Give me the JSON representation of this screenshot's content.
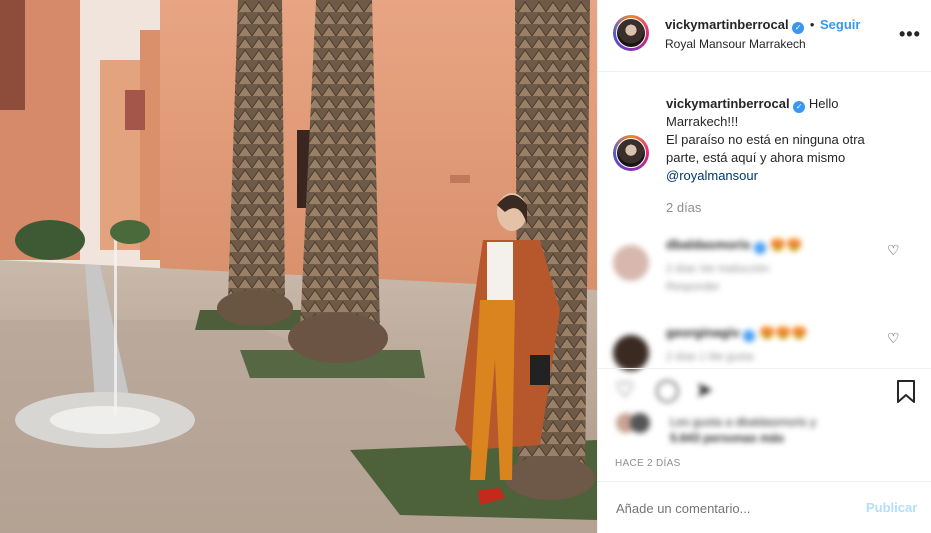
{
  "post": {
    "username": "vickymartinberrocal",
    "verified_icon": "verified-badge-icon",
    "follow_separator": "•",
    "follow_label": "Seguir",
    "location": "Royal Mansour Marrakech"
  },
  "caption": {
    "username": "vickymartinberrocal",
    "line1": "Hello",
    "line2": "Marrakech!!!",
    "line3": "El paraíso no está en ninguna otra",
    "line4": "parte, está aquí y ahora mismo",
    "mention": "@royalmansour",
    "time_ago": "2 días"
  },
  "comments": [
    {
      "username": "dbaldasmoris",
      "emojis": "😍😍",
      "meta": "2 días   Ver traducción",
      "reply": "Responder"
    },
    {
      "username": "georginagiv",
      "emojis": "😍😍😍",
      "meta": "2 días   1 Me gusta",
      "reply": ""
    }
  ],
  "likes": {
    "text": "Les gusta a dbaldasmoris y",
    "text2": "5.643 personas más"
  },
  "timestamp": "HACE 2 DÍAS",
  "comment_box": {
    "placeholder": "Añade un comentario...",
    "publish_label": "Publicar"
  },
  "icons": {
    "more": "more-options-icon",
    "heart": "heart-icon",
    "comment": "comment-icon",
    "share": "share-icon",
    "bookmark": "bookmark-icon"
  },
  "colors": {
    "accent": "#3897f0",
    "publish_disabled": "#b2dffc",
    "text": "#262626",
    "muted": "#8e8e8e"
  }
}
